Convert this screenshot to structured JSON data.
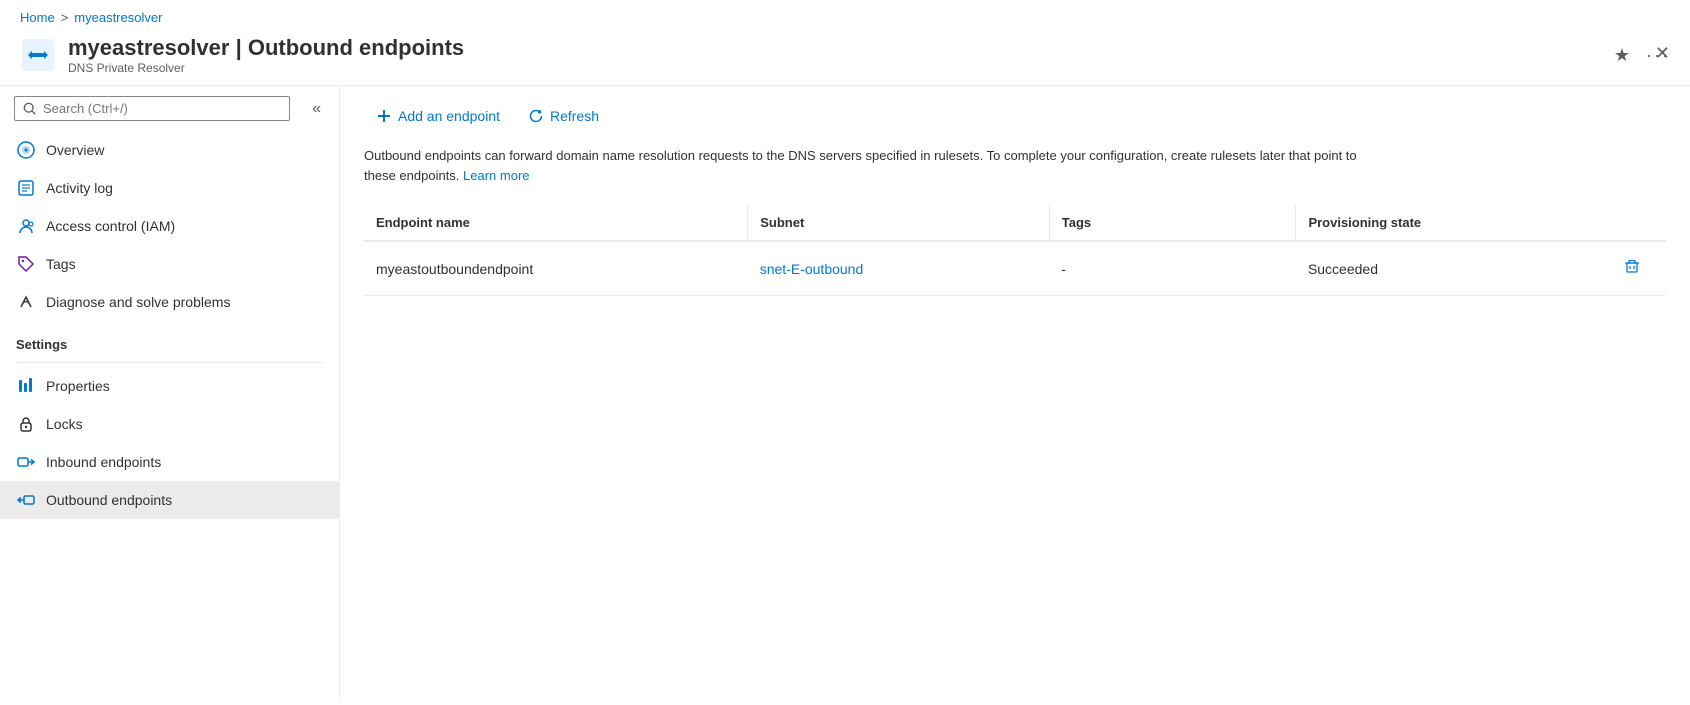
{
  "breadcrumb": {
    "home": "Home",
    "separator": ">",
    "current": "myeastresolver"
  },
  "header": {
    "title": "myeastresolver",
    "separator": " | ",
    "page": "Outbound endpoints",
    "subtitle": "DNS Private Resolver",
    "star_label": "★",
    "more_label": "···",
    "close_label": "✕"
  },
  "sidebar": {
    "search_placeholder": "Search (Ctrl+/)",
    "collapse_label": "«",
    "nav_items": [
      {
        "id": "overview",
        "label": "Overview",
        "icon": "globe"
      },
      {
        "id": "activity-log",
        "label": "Activity log",
        "icon": "activity"
      },
      {
        "id": "access-control",
        "label": "Access control (IAM)",
        "icon": "people"
      },
      {
        "id": "tags",
        "label": "Tags",
        "icon": "tag"
      },
      {
        "id": "diagnose",
        "label": "Diagnose and solve problems",
        "icon": "wrench"
      }
    ],
    "settings_label": "Settings",
    "settings_items": [
      {
        "id": "properties",
        "label": "Properties",
        "icon": "properties"
      },
      {
        "id": "locks",
        "label": "Locks",
        "icon": "lock"
      },
      {
        "id": "inbound-endpoints",
        "label": "Inbound endpoints",
        "icon": "inbound"
      },
      {
        "id": "outbound-endpoints",
        "label": "Outbound endpoints",
        "icon": "outbound",
        "active": true
      }
    ]
  },
  "toolbar": {
    "add_label": "Add an endpoint",
    "refresh_label": "Refresh"
  },
  "description": {
    "text": "Outbound endpoints can forward domain name resolution requests to the DNS servers specified in rulesets. To complete your configuration, create rulesets later that point to these endpoints.",
    "learn_more": "Learn more"
  },
  "table": {
    "columns": [
      "Endpoint name",
      "Subnet",
      "Tags",
      "Provisioning state"
    ],
    "rows": [
      {
        "endpoint_name": "myeastoutboundendpoint",
        "subnet": "snet-E-outbound",
        "subnet_link": "#",
        "tags": "-",
        "provisioning_state": "Succeeded"
      }
    ]
  }
}
